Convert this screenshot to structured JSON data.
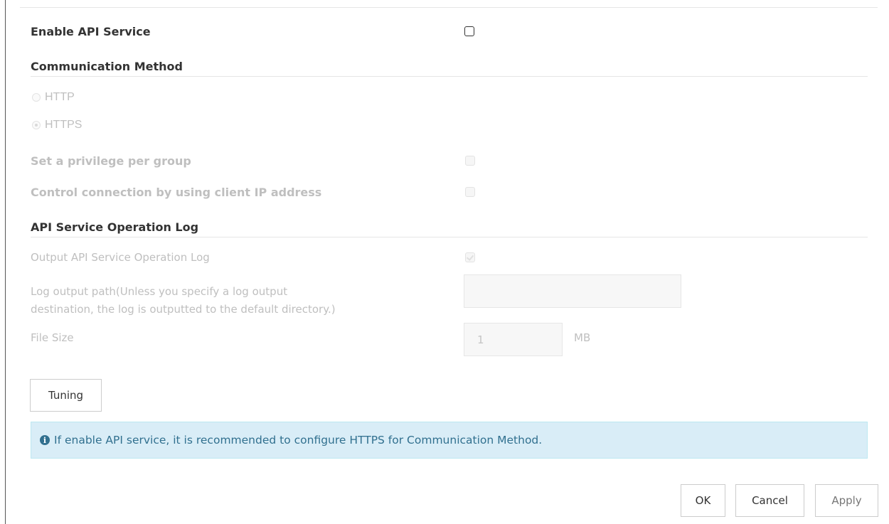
{
  "enable_api_service": {
    "label": "Enable API Service",
    "checked": false
  },
  "communication_method": {
    "heading": "Communication Method",
    "options": [
      {
        "label": "HTTP",
        "selected": false
      },
      {
        "label": "HTTPS",
        "selected": true
      }
    ]
  },
  "privilege_per_group": {
    "label": "Set a privilege per group",
    "checked": false
  },
  "control_connection": {
    "label": "Control connection by using client IP address",
    "checked": false
  },
  "operation_log": {
    "heading": "API Service Operation Log",
    "output_label": "Output API Service Operation Log",
    "output_checked": true,
    "path_label_line1": "Log output path(Unless you specify a log output",
    "path_label_line2": "destination, the log is outputted to the default directory.)",
    "path_value": "",
    "file_size_label": "File Size",
    "file_size_value": "1",
    "file_size_unit": "MB"
  },
  "tuning_button": "Tuning",
  "info_message": "If enable API service, it is recommended to configure HTTPS for Communication Method.",
  "footer": {
    "ok": "OK",
    "cancel": "Cancel",
    "apply": "Apply"
  },
  "colors": {
    "info_bg": "#d9edf7",
    "info_text": "#31708f",
    "disabled_text": "#bfbfbf"
  }
}
